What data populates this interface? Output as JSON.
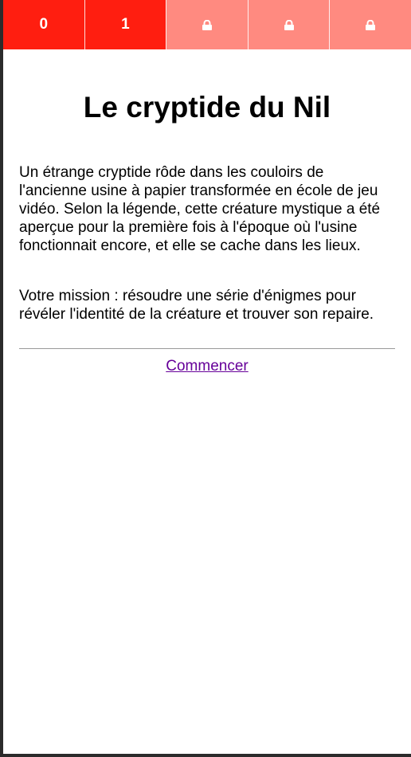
{
  "tabs": [
    {
      "label": "0",
      "state": "unlocked",
      "icon": null
    },
    {
      "label": "1",
      "state": "unlocked",
      "icon": null
    },
    {
      "label": "",
      "state": "locked",
      "icon": "lock-icon"
    },
    {
      "label": "",
      "state": "locked",
      "icon": "lock-icon"
    },
    {
      "label": "",
      "state": "locked",
      "icon": "lock-icon"
    }
  ],
  "main": {
    "title": "Le cryptide du Nil",
    "intro": "Un étrange cryptide rôde dans les couloirs de l'ancienne usine à papier transformée en école de jeu vidéo. Selon la légende, cette créature mystique a été aperçue pour la première fois à l'époque où l'usine fonctionnait encore, et elle se cache dans les lieux.",
    "mission": "Votre mission : résoudre une série d'énigmes pour révéler l'identité de la créature et trouver son repaire.",
    "start_label": "Commencer"
  },
  "colors": {
    "tab_unlocked": "#ff1e10",
    "tab_locked": "#ff8a80",
    "link_visited": "#660099",
    "divider": "#999999"
  }
}
